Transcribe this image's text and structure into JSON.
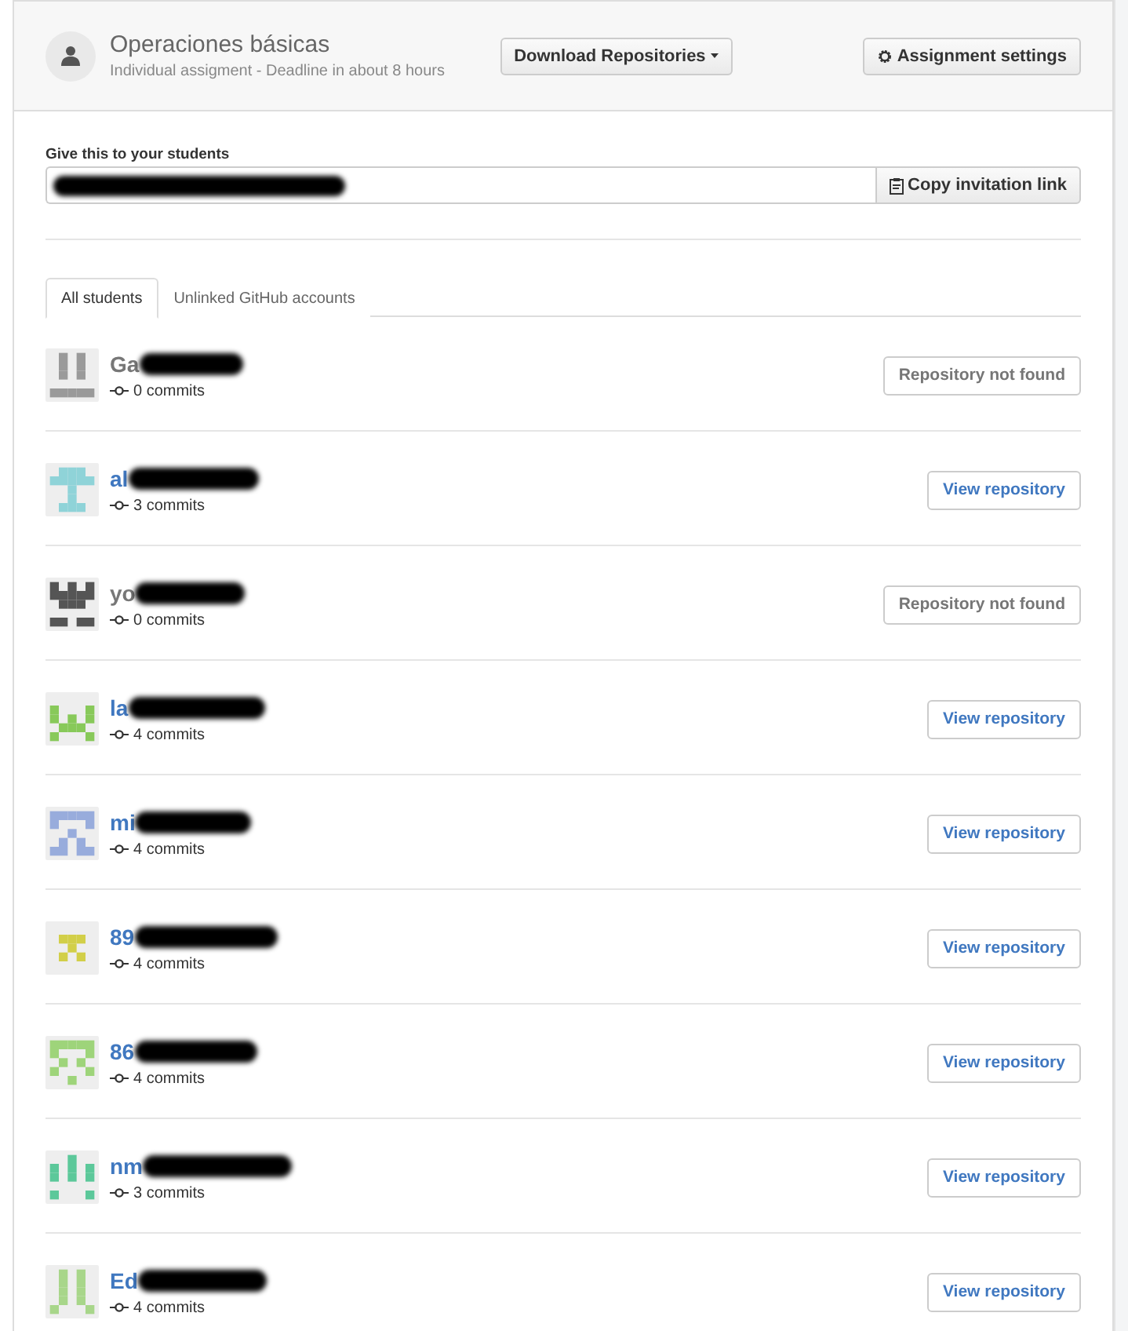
{
  "assignment": {
    "title": "Operaciones básicas",
    "subtitle": "Individual assigment - Deadline in about 8 hours"
  },
  "buttons": {
    "download": "Download Repositories",
    "settings": "Assignment settings"
  },
  "invitation": {
    "label": "Give this to your students",
    "redacted": true,
    "copy_button": "Copy invitation link"
  },
  "tabs": [
    {
      "label": "All students",
      "selected": true
    },
    {
      "label": "Unlinked GitHub accounts",
      "selected": false
    }
  ],
  "students": [
    {
      "name": "Ga",
      "redacted": true,
      "color": "#9a9a9a",
      "commits": "0 commits",
      "kind": "missing",
      "action": "Repository not found"
    },
    {
      "name": "al",
      "redacted": true,
      "color": "#8fd3d8",
      "commits": "3 commits",
      "kind": "found",
      "action": "View repository"
    },
    {
      "name": "yo",
      "redacted": true,
      "color": "#555555",
      "commits": "0 commits",
      "kind": "missing",
      "action": "Repository not found"
    },
    {
      "name": "la",
      "redacted": true,
      "color": "#88c95a",
      "commits": "4 commits",
      "kind": "found",
      "action": "View repository"
    },
    {
      "name": "mi",
      "redacted": true,
      "color": "#98acdc",
      "commits": "4 commits",
      "kind": "found",
      "action": "View repository"
    },
    {
      "name": "89",
      "redacted": true,
      "color": "#d2cf48",
      "commits": "4 commits",
      "kind": "found",
      "action": "View repository"
    },
    {
      "name": "86",
      "redacted": true,
      "color": "#9ed47a",
      "commits": "4 commits",
      "kind": "found",
      "action": "View repository"
    },
    {
      "name": "nm",
      "redacted": true,
      "color": "#5cc89a",
      "commits": "3 commits",
      "kind": "found",
      "action": "View repository"
    },
    {
      "name": "Ed",
      "redacted": true,
      "color": "#a8d68a",
      "commits": "4 commits",
      "kind": "found",
      "action": "View repository"
    }
  ]
}
